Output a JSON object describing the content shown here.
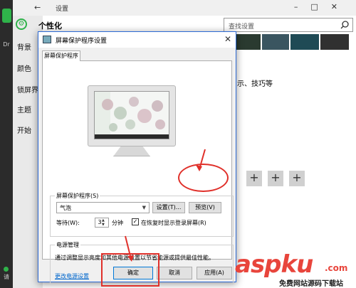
{
  "settings": {
    "title": "设置",
    "heading": "个性化",
    "search_placeholder": "查找设置",
    "nav": [
      "背景",
      "颜色",
      "锁屏界",
      "主题",
      "开始"
    ],
    "tips_text": "示、技巧等",
    "strip_labels": [
      "Dr",
      "请"
    ]
  },
  "dialog": {
    "title": "屏幕保护程序设置",
    "tab": "屏幕保护程序",
    "screensaver_group": "屏幕保护程序(S)",
    "selected_screensaver": "气泡",
    "settings_button": "设置(T)...",
    "preview_button": "预览(V)",
    "wait_label": "等待(W):",
    "wait_value": "3",
    "minutes_label": "分钟",
    "resume_checkbox_label": "在恢复时显示登录屏幕(R)",
    "resume_checked": true,
    "power_group": "电源管理",
    "power_description": "通过调整显示亮度和其他电源设置以节省能源或提供最佳性能。",
    "power_link": "更改电源设置",
    "ok_button": "确定",
    "cancel_button": "取消",
    "apply_button": "应用(A)"
  },
  "watermark": {
    "main": "aspku",
    "sub": "免费网站源码下载站",
    "tld": ".com"
  },
  "colors": {
    "accent_green": "#2fb34a",
    "annotation_red": "#e0302a",
    "link_blue": "#0066cc"
  }
}
